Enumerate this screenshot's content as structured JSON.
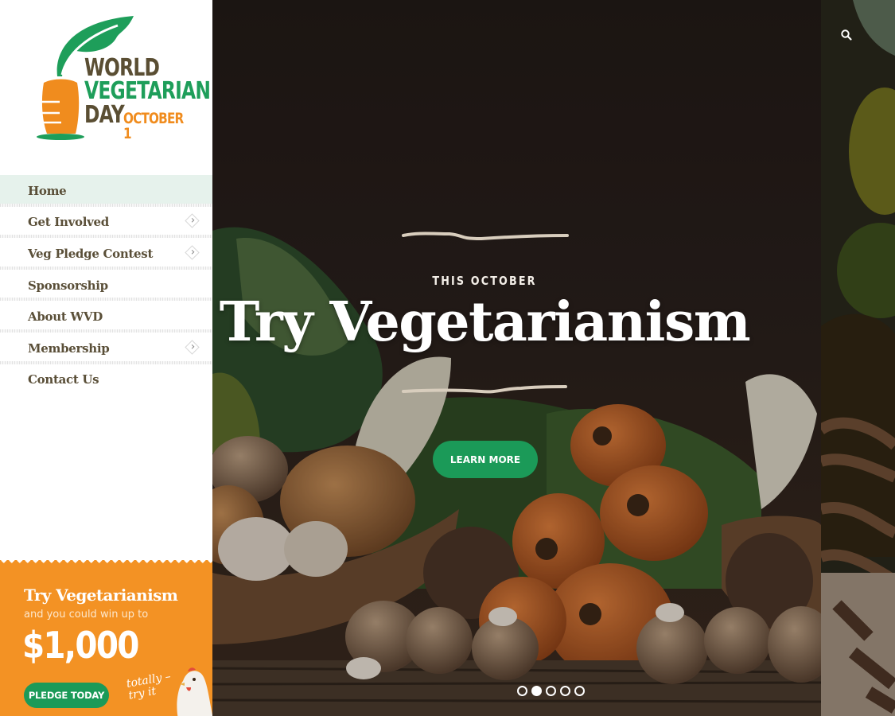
{
  "logo": {
    "line1": "WORLD",
    "line2": "VEGETARIAN",
    "line3": "DAY",
    "date": "OCTOBER 1",
    "colors": {
      "brown": "#5a4e33",
      "green": "#1e9e5a",
      "orange": "#f08c1e"
    }
  },
  "nav": {
    "items": [
      {
        "label": "Home",
        "active": true,
        "has_submenu": false
      },
      {
        "label": "Get Involved",
        "active": false,
        "has_submenu": true
      },
      {
        "label": "Veg Pledge Contest",
        "active": false,
        "has_submenu": true
      },
      {
        "label": "Sponsorship",
        "active": false,
        "has_submenu": false
      },
      {
        "label": "About WVD",
        "active": false,
        "has_submenu": false
      },
      {
        "label": "Membership",
        "active": false,
        "has_submenu": true
      },
      {
        "label": "Contact Us",
        "active": false,
        "has_submenu": false
      }
    ]
  },
  "promo": {
    "title": "Try Vegetarianism",
    "subtitle": "and you could win up to",
    "amount": "$1,000",
    "button_label": "PLEDGE TODAY",
    "handwritten_line1": "totally –",
    "handwritten_line2": "try it",
    "background_color": "#f39224"
  },
  "hero": {
    "kicker": "THIS OCTOBER",
    "title": "Try Vegetarianism",
    "button_label": "LEARN MORE",
    "accent_color": "#1b9a58",
    "slider": {
      "total_slides": 5,
      "active_index": 1
    }
  },
  "header": {
    "search_icon": "search-icon"
  }
}
